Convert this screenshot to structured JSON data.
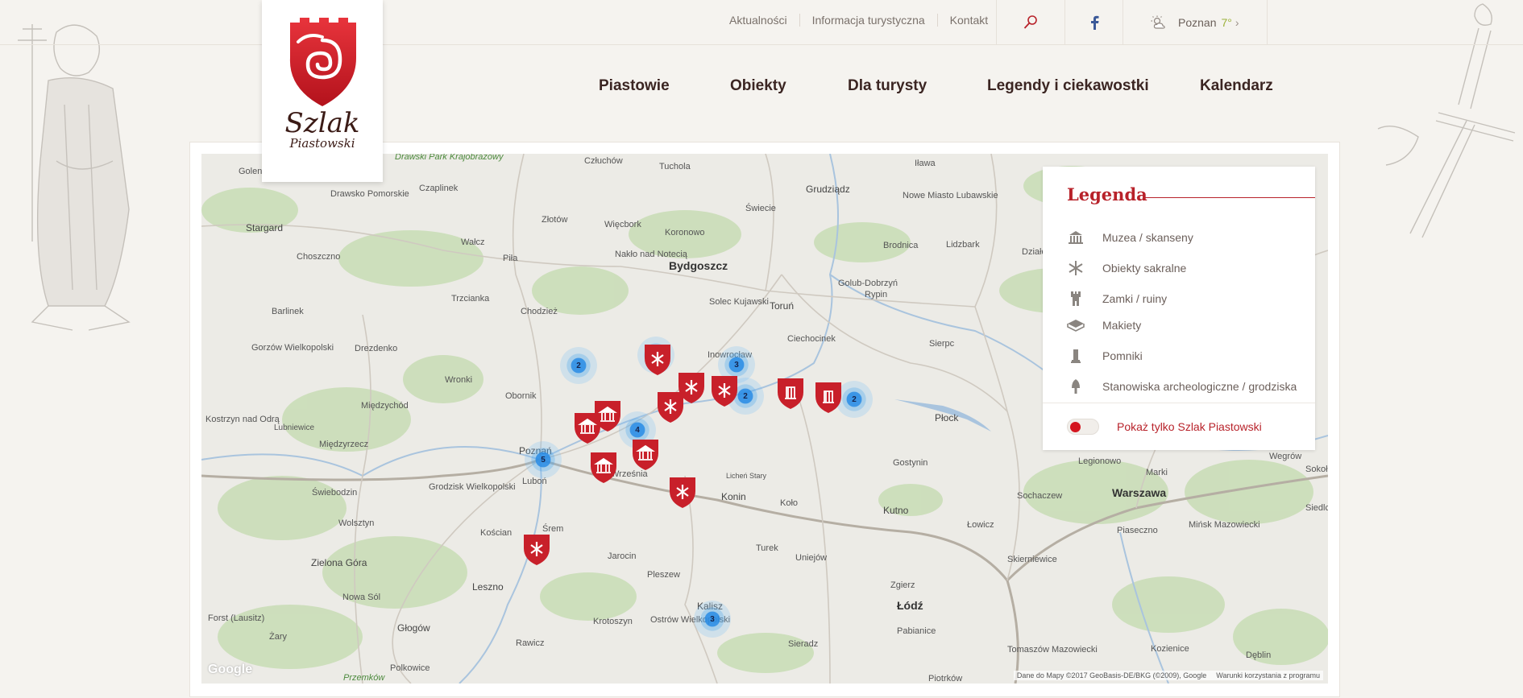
{
  "toplinks": [
    "Aktualności",
    "Informacja turystyczna",
    "Kontakt"
  ],
  "weather": {
    "city": "Poznan",
    "temp": "7°",
    "chev": "›"
  },
  "logo": {
    "name": "Szlak",
    "sub": "Piastowski"
  },
  "nav": [
    "Piastowie",
    "Obiekty",
    "Dla turysty",
    "Legendy i ciekawostki",
    "Kalendarz"
  ],
  "legend": {
    "title": "Legenda",
    "items": [
      {
        "label": "Muzea / skanseny",
        "icon": "museum-icon"
      },
      {
        "label": "Obiekty sakralne",
        "icon": "sacral-icon"
      },
      {
        "label": "Zamki / ruiny",
        "icon": "castle-icon"
      },
      {
        "label": "Makiety",
        "icon": "model-icon"
      },
      {
        "label": "Pomniki",
        "icon": "monument-icon"
      },
      {
        "label": "Stanowiska archeologiczne / grodziska",
        "icon": "archaeology-icon"
      }
    ],
    "toggle_label": "Pokaż tylko Szlak Piastowski"
  },
  "map": {
    "google": "Google",
    "attribution": "Dane do Mapy ©2017 GeoBasis-DE/BKG (©2009), Google",
    "terms": "Warunki korzystania z programu",
    "clusters": [
      "2",
      "3",
      "3",
      "2",
      "2",
      "4",
      "5",
      "3"
    ],
    "places": [
      "Golenów",
      "Drawsko Pomorskie",
      "Drawski Park Krajobrazowy",
      "Czaplinek",
      "Człuchów",
      "Tuchola",
      "Grudziądz",
      "Iława",
      "Stargard",
      "Wałcz",
      "Złotów",
      "Więcbork",
      "Koronowo",
      "Świecie",
      "Nowe Miasto Lubawskie",
      "Choszczno",
      "Piła",
      "Nakło nad Notecią",
      "Bydgoszcz",
      "Brodnica",
      "Lidzbark",
      "Działdowo",
      "Barlinek",
      "Trzcianka",
      "Chodzież",
      "Solec Kujawski",
      "Toruń",
      "Golub-Dobrzyń",
      "Rypin",
      "Drezdenko",
      "Ciechocinek",
      "Sierpc",
      "Gorzów Wielkopolski",
      "Wronki",
      "Inowrocław",
      "Międzychód",
      "Obornik",
      "Kostrzyn nad Odrą",
      "Lubniewice",
      "Płock",
      "Poznań",
      "Luboń",
      "Międzyrzecz",
      "Września",
      "Gostynin",
      "Legionowo",
      "Marki",
      "Wegrów",
      "Świebodzin",
      "Grodzisk Wielkopolski",
      "Licheń Stary",
      "Konin",
      "Koło",
      "Kutno",
      "Sochaczew",
      "Warszawa",
      "Wolsztyn",
      "Śrem",
      "Kościan",
      "Piaseczno",
      "Mińsk Mazowiecki",
      "Zielona Góra",
      "Jarocin",
      "Turek",
      "Uniejów",
      "Łowicz",
      "Skierniewice",
      "Nowa Sól",
      "Leszno",
      "Pleszew",
      "Kalisz",
      "Zgierz",
      "Łódź",
      "Forst (Lausitz)",
      "Żary",
      "Głogów",
      "Krotoszyn",
      "Ostrów Wielkopolski",
      "Sieradz",
      "Pabianice",
      "Tomaszów Mazowiecki",
      "Kozienice",
      "Rawicz",
      "Polkowice",
      "Przemków",
      "Piotrków",
      "Dęblin",
      "Siedlce",
      "Sokołów"
    ]
  }
}
